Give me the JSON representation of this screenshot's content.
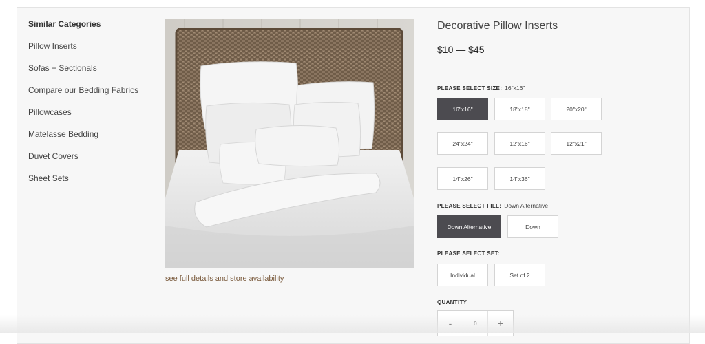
{
  "sidebar": {
    "title": "Similar Categories",
    "items": [
      {
        "label": "Pillow Inserts"
      },
      {
        "label": "Sofas + Sectionals"
      },
      {
        "label": "Compare our Bedding Fabrics"
      },
      {
        "label": "Pillowcases"
      },
      {
        "label": "Matelasse Bedding"
      },
      {
        "label": "Duvet Covers"
      },
      {
        "label": "Sheet Sets"
      }
    ]
  },
  "product": {
    "title": "Decorative Pillow Inserts",
    "price": "$10 — $45",
    "details_link": "see full details and store availability",
    "image_alt": "pillow-inserts-on-bed-photo"
  },
  "size": {
    "label": "PLEASE SELECT SIZE:",
    "selected": "16\"x16\"",
    "options": [
      "16\"x16\"",
      "18\"x18\"",
      "20\"x20\"",
      "24\"x24\"",
      "12\"x16\"",
      "12\"x21\"",
      "14\"x26\"",
      "14\"x36\""
    ]
  },
  "fill": {
    "label": "PLEASE SELECT FILL:",
    "selected": "Down Alternative",
    "options": [
      "Down Alternative",
      "Down"
    ]
  },
  "set": {
    "label": "PLEASE SELECT SET:",
    "options": [
      "Individual",
      "Set of 2"
    ]
  },
  "quantity": {
    "label": "QUANTITY",
    "minus": "-",
    "value": "0",
    "plus": "+"
  },
  "colors": {
    "selected_button": "#4c4b50",
    "link": "#7a5a3c"
  }
}
